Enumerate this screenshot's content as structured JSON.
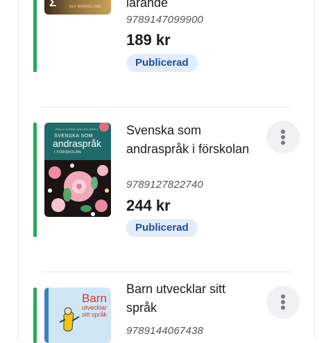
{
  "books": [
    {
      "title": "lärande",
      "isbn": "9789147099900",
      "price": "189 kr",
      "status": "Publicerad",
      "cover": {
        "glyph": "Σ",
        "author": "ULF BRÄNDLUND"
      }
    },
    {
      "title": "Svenska som andraspråk i förskolan",
      "isbn": "9789127822740",
      "price": "244 kr",
      "status": "Publicerad",
      "cover": {
        "author": "POLLY BJÖRK-WILLÉN (RED.)",
        "line1": "SVENSKA SOM",
        "line2": "andraspråk",
        "line3": "I FÖRSKOLAN"
      }
    },
    {
      "title": "Barn utvecklar sitt språk",
      "isbn": "9789144067438",
      "cover": {
        "line1": "Barn",
        "line2": "utvecklar",
        "line3": "sitt språk"
      }
    }
  ],
  "colors": {
    "accent": "#2aa85a",
    "badge_bg": "#e3ecfb",
    "badge_text": "#1e4e9c"
  },
  "icons": {
    "more": "more-vert-icon"
  }
}
